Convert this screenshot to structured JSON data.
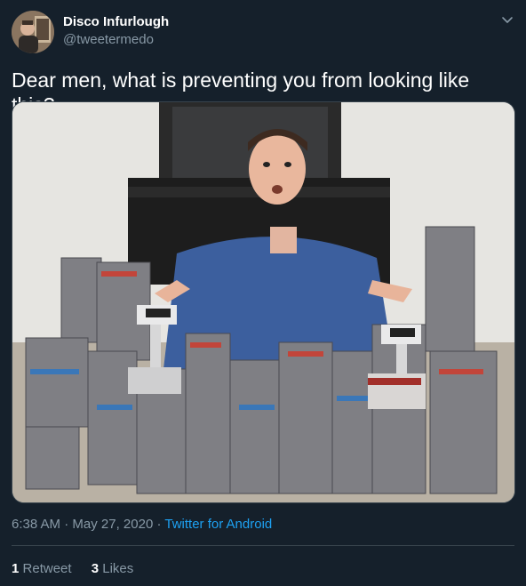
{
  "user": {
    "display_name": "Disco Infurlough",
    "handle": "@tweetermedo",
    "avatar_icon": "avatar-photo"
  },
  "tweet": {
    "text": "Dear men, what is preventing you from looking like this?",
    "image_icon": "photo-man-with-nes-cartridges"
  },
  "meta": {
    "time": "6:38 AM",
    "sep1": " · ",
    "date": "May 27, 2020",
    "sep2": " · ",
    "source": "Twitter for Android"
  },
  "stats": {
    "retweets_count": "1",
    "retweets_label": "Retweet",
    "likes_count": "3",
    "likes_label": "Likes"
  },
  "colors": {
    "background": "#15202b",
    "primary_text": "#ffffff",
    "secondary_text": "#8899a6",
    "link": "#1da1f2",
    "divider": "#38444d"
  }
}
